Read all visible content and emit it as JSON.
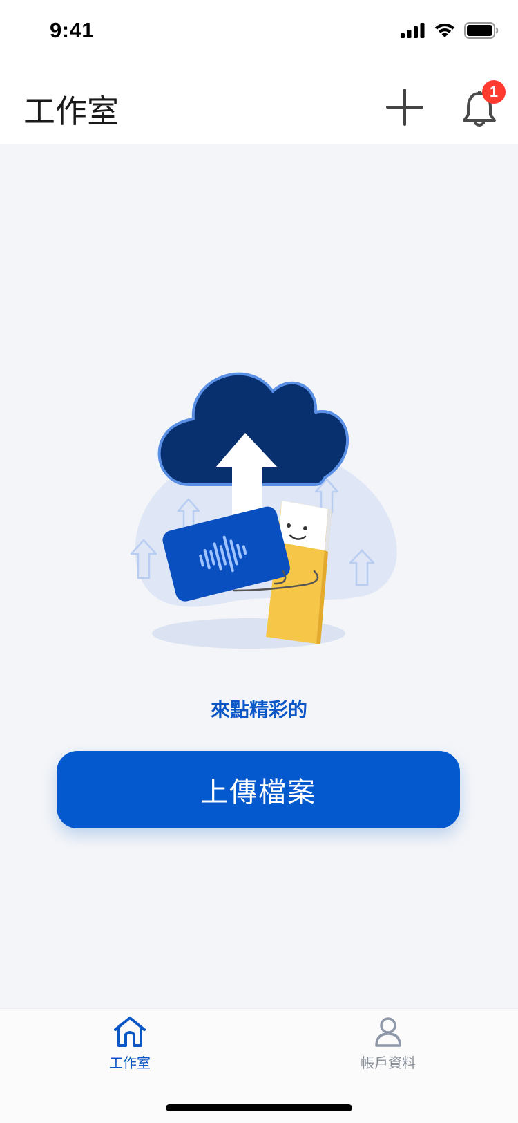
{
  "status_bar": {
    "time": "9:41"
  },
  "header": {
    "title": "工作室",
    "add_icon": "plus-icon",
    "notification_icon": "bell-icon",
    "notification_badge": "1"
  },
  "main": {
    "empty_state_text": "來點精彩的",
    "upload_button_label": "上傳檔案"
  },
  "tab_bar": {
    "items": [
      {
        "label": "工作室",
        "icon": "home-icon",
        "active": true
      },
      {
        "label": "帳戶資料",
        "icon": "person-icon",
        "active": false
      }
    ]
  },
  "colors": {
    "accent": "#0459cf",
    "active_tab": "#0b57c5",
    "inactive_tab": "#8a9099",
    "badge": "#ff3b30",
    "background": "#f3f5f8",
    "cloud": "#08306e",
    "file_yellow": "#f5c648"
  }
}
